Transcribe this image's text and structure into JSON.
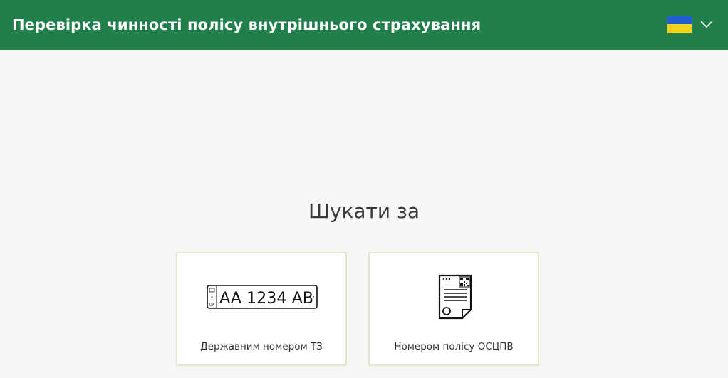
{
  "header": {
    "title": "Перевірка чинності полісу внутрішнього страхування",
    "language_flag_icon": "ukraine-flag-icon",
    "language_dropdown_icon": "chevron-down-icon"
  },
  "main": {
    "heading": "Шукати за",
    "options": [
      {
        "label": "Державним номером ТЗ",
        "icon": "license-plate-icon",
        "plate_text": "AA 1234 AB",
        "plate_country": "UA"
      },
      {
        "label": "Номером полісу ОСЦПВ",
        "icon": "policy-document-icon"
      }
    ]
  },
  "colors": {
    "header_bg": "#217f4b",
    "page_bg": "#f6f6f6",
    "card_border": "#e6e4cb",
    "flag_blue": "#1f5fd1",
    "flag_yellow": "#f7d31d"
  }
}
